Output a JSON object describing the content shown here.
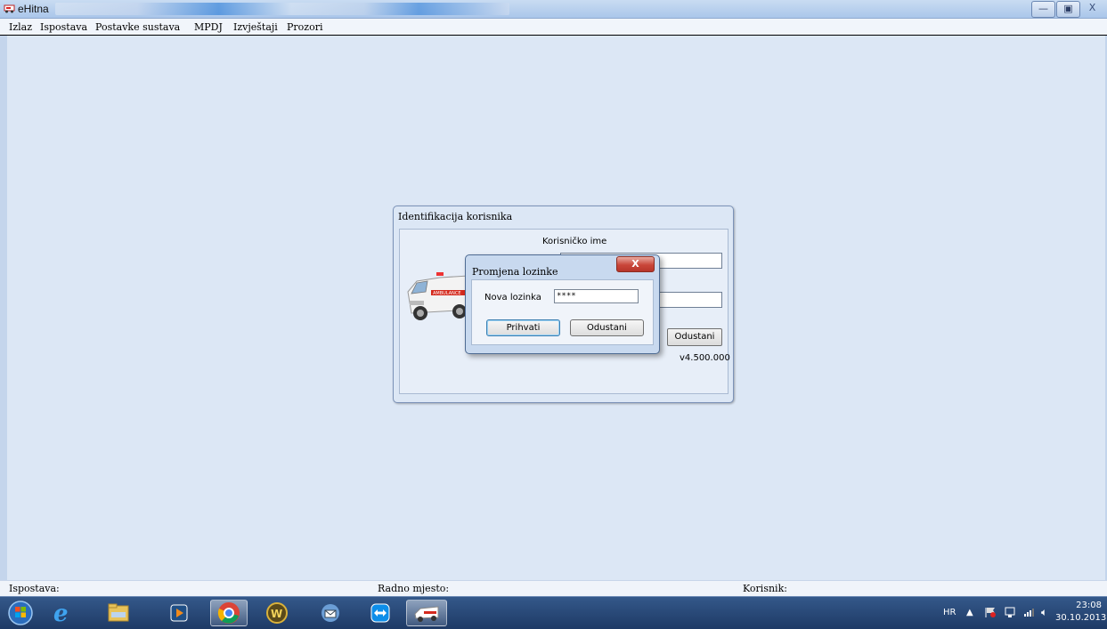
{
  "window": {
    "title": "eHitna",
    "buttons": {
      "minimize": "—",
      "maximize": "▣",
      "close": "X"
    }
  },
  "menu": [
    "Izlaz",
    "Ispostava",
    "Postavke sustava",
    "MPDJ",
    "Izvještaji",
    "Prozori"
  ],
  "login_dialog": {
    "title": "Identifikacija korisnika",
    "username_label": "Korisničko ime",
    "cancel_label": "Odustani",
    "version": "v4.500.000"
  },
  "password_dialog": {
    "title": "Promjena lozinke",
    "close_label": "X",
    "new_password_label": "Nova lozinka",
    "new_password_value": "****",
    "accept_label": "Prihvati",
    "cancel_label": "Odustani"
  },
  "status": {
    "branch_label": "Ispostava:",
    "workplace_label": "Radno mjesto:",
    "user_label": "Korisnik:"
  },
  "taskbar": {
    "apps": [
      "start",
      "internet-explorer",
      "file-explorer",
      "media-player",
      "chrome",
      "winamp",
      "thunderbird",
      "teamviewer",
      "ehitna"
    ],
    "tray": {
      "language": "HR",
      "time": "23:08",
      "date": "30.10.2013."
    }
  }
}
